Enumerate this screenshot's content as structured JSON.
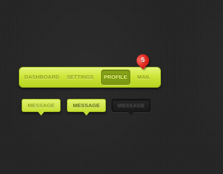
{
  "nav": {
    "items": [
      {
        "label": "DASHBOARD",
        "active": false
      },
      {
        "label": "SETTINGS",
        "active": false
      },
      {
        "label": "PROFILE",
        "active": true
      },
      {
        "label": "MAIL",
        "active": false
      }
    ],
    "mail_badge": {
      "count": "5",
      "icon": "map-pin-icon",
      "color": "#e0281f"
    }
  },
  "tooltips": [
    {
      "label": "MESSAGE",
      "style": "light"
    },
    {
      "label": "MESSAGE",
      "style": "light"
    },
    {
      "label": "MESSAGE",
      "style": "dark"
    }
  ],
  "colors": {
    "accent": "#cde53a",
    "active_tab": "#7b9612",
    "badge": "#e0281f",
    "background": "#232323"
  }
}
